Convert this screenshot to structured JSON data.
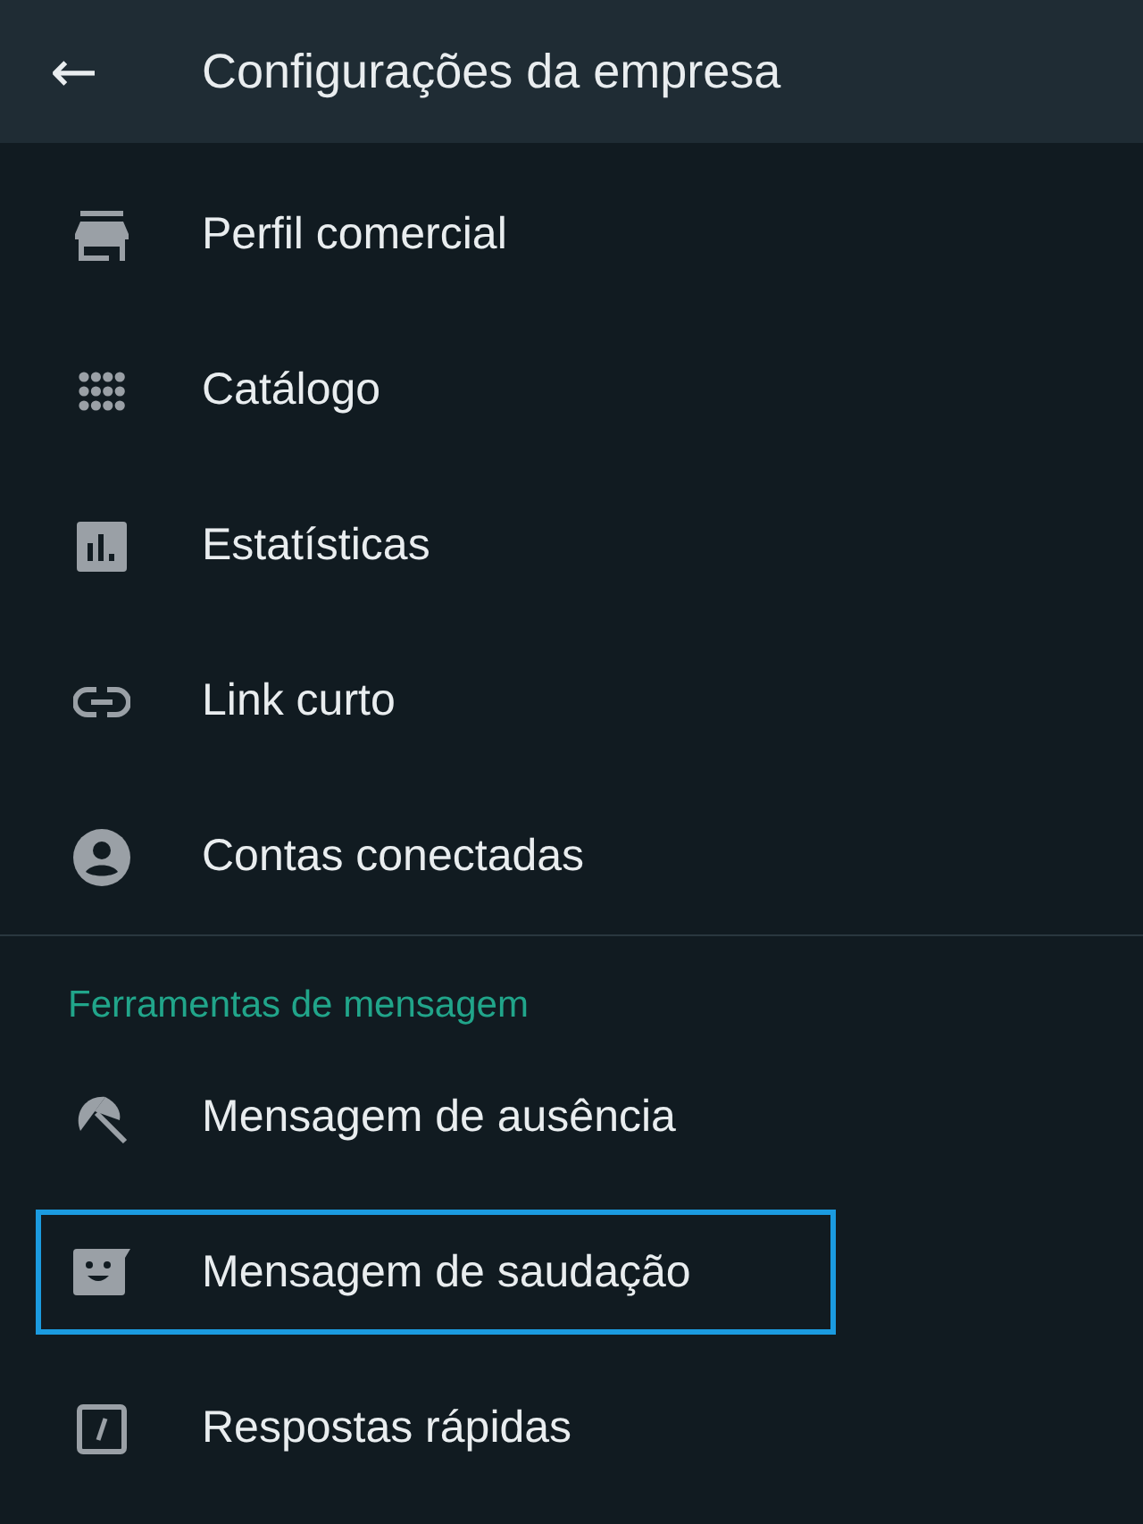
{
  "header": {
    "back": "←",
    "title": "Configurações da empresa"
  },
  "sections": [
    {
      "items": [
        {
          "kind": "store",
          "label": "Perfil comercial",
          "selected": false
        },
        {
          "kind": "grid",
          "label": "Catálogo",
          "selected": false
        },
        {
          "kind": "chart",
          "label": "Estatísticas",
          "selected": false
        },
        {
          "kind": "link",
          "label": "Link curto",
          "selected": false
        },
        {
          "kind": "account",
          "label": "Contas conectadas",
          "selected": false
        }
      ]
    },
    {
      "title": "Ferramentas de mensagem",
      "items": [
        {
          "kind": "umbrella",
          "label": "Mensagem de ausência",
          "selected": false
        },
        {
          "kind": "greeting",
          "label": "Mensagem de saudação",
          "selected": true
        },
        {
          "kind": "quick",
          "label": "Respostas rápidas",
          "selected": false
        }
      ]
    }
  ]
}
